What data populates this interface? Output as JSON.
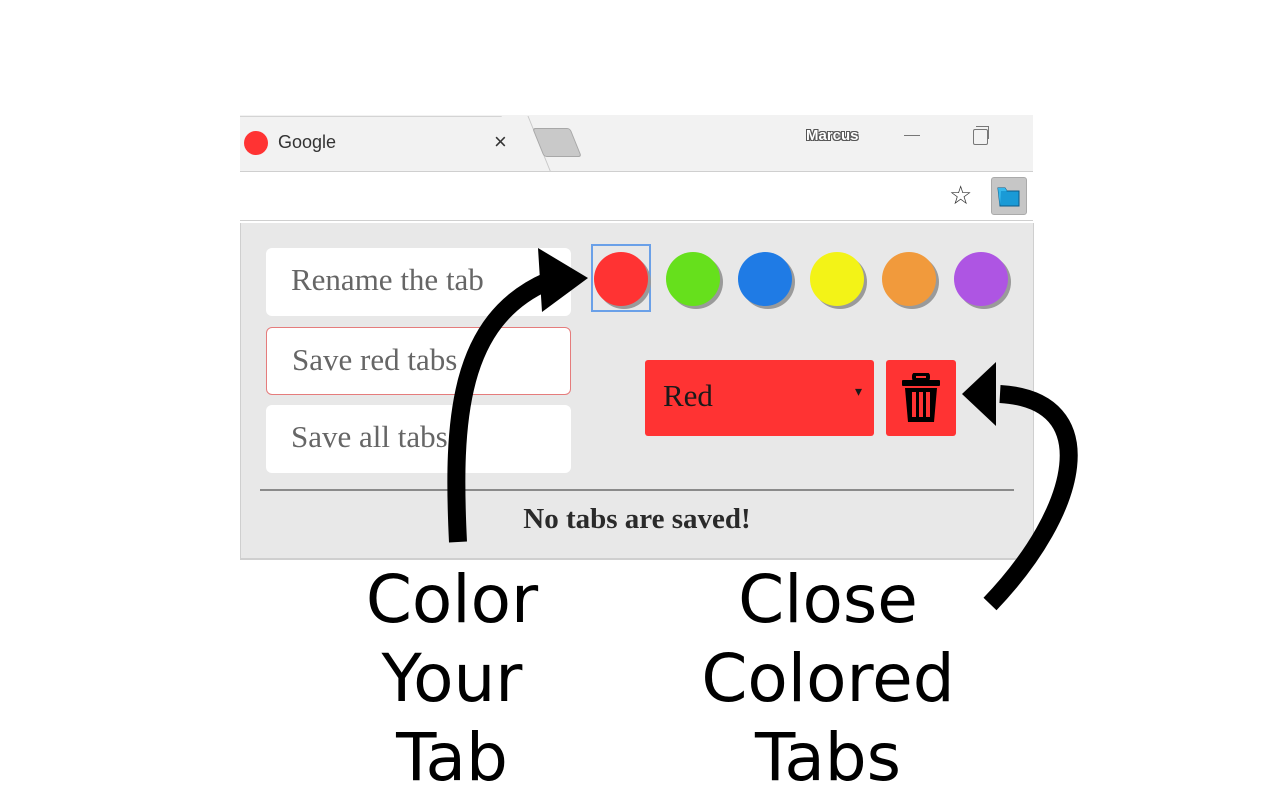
{
  "browser": {
    "tab": {
      "title": "Google",
      "favicon_color": "#ff3333",
      "close_glyph": "×"
    },
    "profile_name": "Marcus",
    "toolbar": {
      "star_glyph": "☆"
    }
  },
  "popup": {
    "buttons": {
      "rename": "Rename the tab",
      "save_red": "Save red tabs",
      "save_all": "Save all tabs"
    },
    "colors": [
      {
        "name": "red",
        "hex": "#ff3333",
        "selected": true
      },
      {
        "name": "green",
        "hex": "#66e01c"
      },
      {
        "name": "blue",
        "hex": "#1f7be5"
      },
      {
        "name": "yellow",
        "hex": "#f3f317"
      },
      {
        "name": "orange",
        "hex": "#f19a3c"
      },
      {
        "name": "purple",
        "hex": "#ae55e3"
      }
    ],
    "select": {
      "value": "Red",
      "color": "#ff3333",
      "caret": "▾"
    },
    "trash_color": "#ff3333",
    "status": "No tabs are saved!"
  },
  "captions": {
    "left": [
      "Color",
      "Your",
      "Tab"
    ],
    "right": [
      "Close",
      "Colored",
      "Tabs"
    ]
  }
}
